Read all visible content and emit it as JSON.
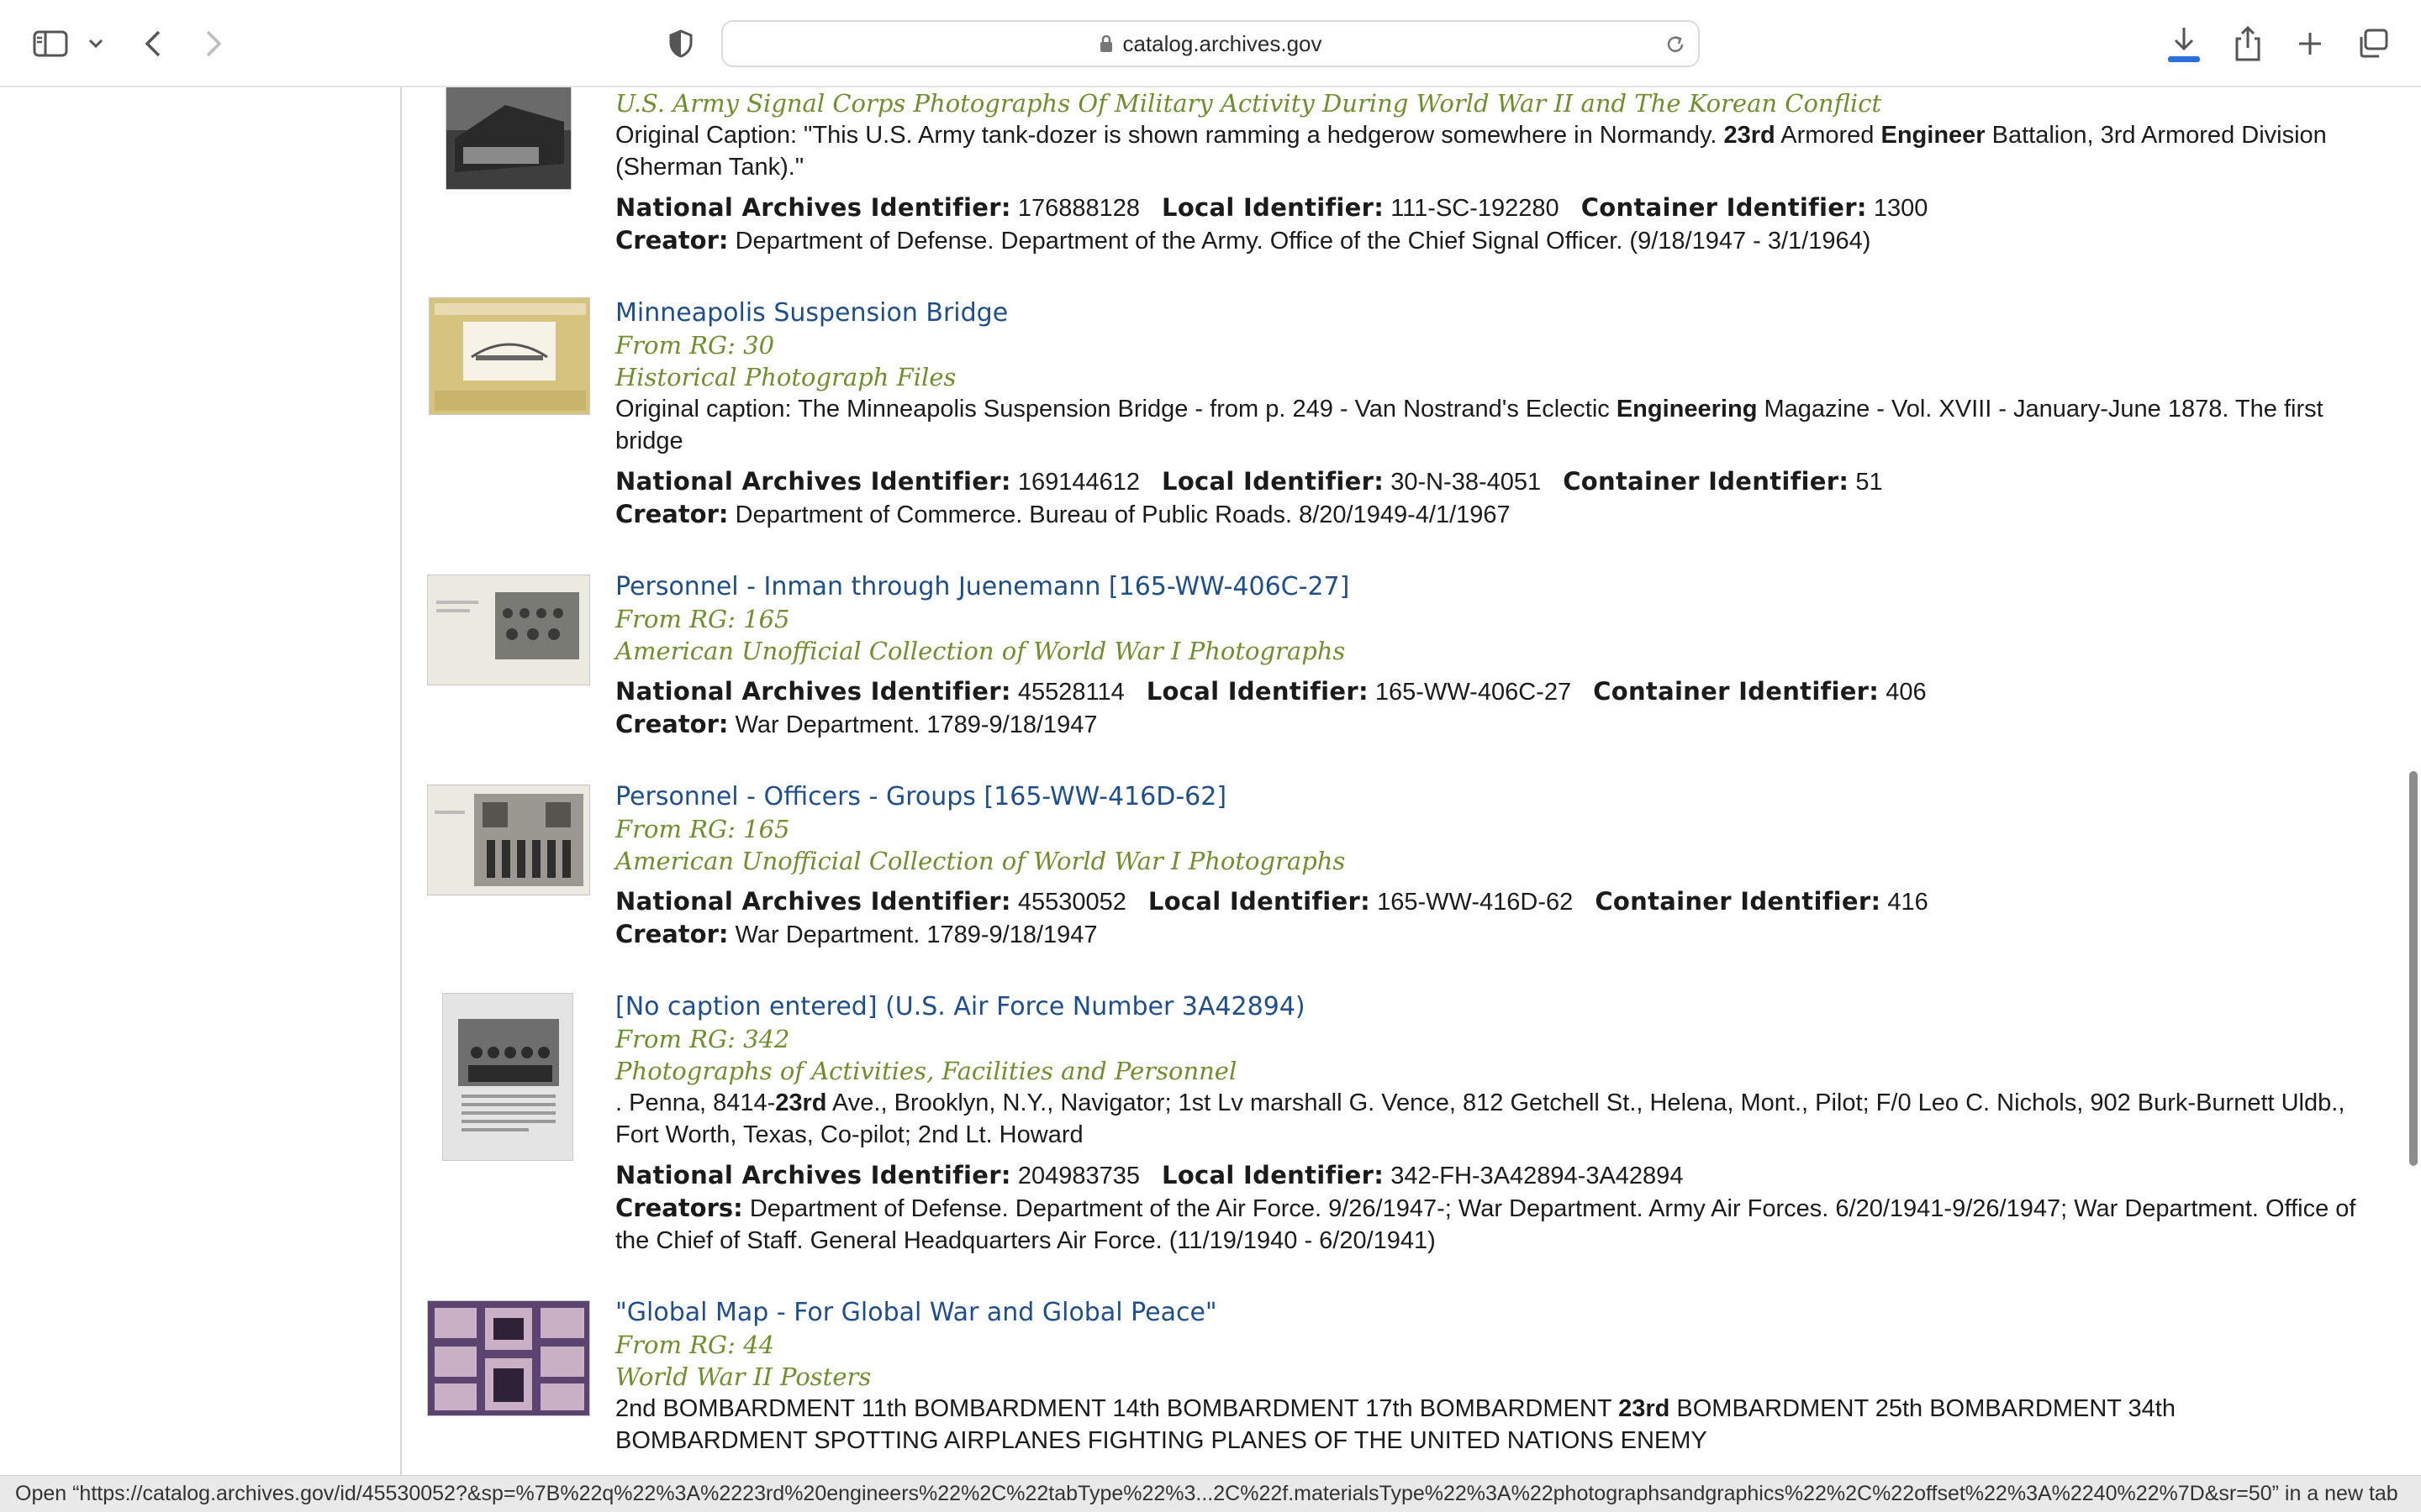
{
  "browser": {
    "url": "catalog.archives.gov",
    "status_text": "Open “https://catalog.archives.gov/id/45530052?&sp=%7B%22q%22%3A%2223rd%20engineers%22%2C%22tabType%22%3...2C%22f.materialsType%22%3A%22photographsandgraphics%22%2C%22offset%22%3A%2240%22%7D&sr=50” in a new tab"
  },
  "labels": {
    "naid": "National Archives Identifier:",
    "local": "Local Identifier:",
    "container": "Container Identifier:",
    "creator": "Creator:",
    "creators": "Creators:"
  },
  "results": [
    {
      "series": "U.S. Army Signal Corps Photographs Of Military Activity During World War II and The Korean Conflict",
      "desc_a": "Original Caption: \"This U.S. Army tank-dozer is shown ramming a hedgerow somewhere in Normandy. ",
      "desc_b1": "23rd",
      "desc_c": " Armored ",
      "desc_b2": "Engineer",
      "desc_d": " Battalion, 3rd Armored Division (Sherman Tank).\"",
      "naid": "176888128",
      "local": "111-SC-192280",
      "container": "1300",
      "creator": "Department of Defense. Department of the Army. Office of the Chief Signal Officer. (9/18/1947 - 3/1/1964)"
    },
    {
      "title": "Minneapolis Suspension Bridge",
      "rg": "From RG: 30",
      "series": "Historical Photograph Files",
      "desc_a": "Original caption: The Minneapolis Suspension Bridge - from p. 249 - Van Nostrand's Eclectic ",
      "desc_b1": "Engineering",
      "desc_c": " Magazine - Vol. XVIII - January-June 1878. The first bridge",
      "naid": "169144612",
      "local": "30-N-38-4051",
      "container": "51",
      "creator": "Department of Commerce. Bureau of Public Roads. 8/20/1949-4/1/1967"
    },
    {
      "title": "Personnel - Inman through Juenemann [165-WW-406C-27]",
      "rg": "From RG: 165",
      "series": "American Unofficial Collection of World War I Photographs",
      "naid": "45528114",
      "local": "165-WW-406C-27",
      "container": "406",
      "creator": "War Department. 1789-9/18/1947"
    },
    {
      "title": "Personnel - Officers - Groups [165-WW-416D-62]",
      "rg": "From RG: 165",
      "series": "American Unofficial Collection of World War I Photographs",
      "naid": "45530052",
      "local": "165-WW-416D-62",
      "container": "416",
      "creator": "War Department. 1789-9/18/1947"
    },
    {
      "title": "[No caption entered] (U.S. Air Force Number 3A42894)",
      "rg": "From RG: 342",
      "series": "Photographs of Activities, Facilities and Personnel",
      "desc_a": ". Penna, 8414-",
      "desc_b1": "23rd",
      "desc_c": " Ave., Brooklyn, N.Y., Navigator; 1st Lv marshall G. Vence, 812 Getchell St., Helena, Mont., Pilot; F/0 Leo C. Nichols, 902 Burk-Burnett Uldb., Fort Worth, Texas, Co-pilot; 2nd Lt. Howard",
      "naid": "204983735",
      "local": "342-FH-3A42894-3A42894",
      "creator": "Department of Defense. Department of the Air Force. 9/26/1947-; War Department. Army Air Forces. 6/20/1941-9/26/1947; War Department. Office of the Chief of Staff. General Headquarters Air Force. (11/19/1940 - 6/20/1941)"
    },
    {
      "title": "\"Global Map - For Global War and Global Peace\"",
      "rg": "From RG: 44",
      "series": "World War II Posters",
      "desc_a": "2nd BOMBARDMENT 11th BOMBARDMENT 14th BOMBARDMENT 17th BOMBARDMENT ",
      "desc_b1": "23rd",
      "desc_c": " BOMBARDMENT 25th BOMBARDMENT 34th BOMBARDMENT SPOTTING AIRPLANES FIGHTING PLANES OF THE UNITED NATIONS ENEMY"
    }
  ]
}
